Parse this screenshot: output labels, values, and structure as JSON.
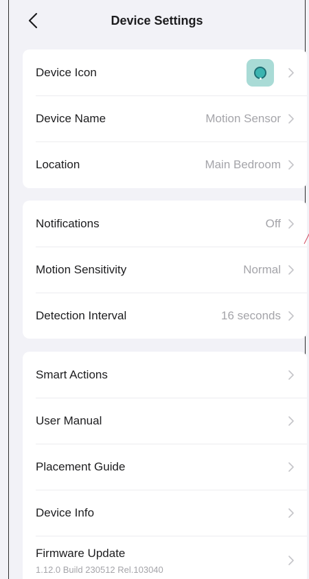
{
  "header": {
    "title": "Device Settings",
    "back_icon": "chevron-left-icon"
  },
  "group1": {
    "device_icon_label": "Device Icon",
    "device_icon_color": "#a9dbd6",
    "device_name_label": "Device Name",
    "device_name_value": "Motion Sensor",
    "location_label": "Location",
    "location_value": "Main Bedroom"
  },
  "group2": {
    "notifications_label": "Notifications",
    "notifications_value": "Off",
    "motion_sensitivity_label": "Motion Sensitivity",
    "motion_sensitivity_value": "Normal",
    "detection_interval_label": "Detection Interval",
    "detection_interval_value": "16 seconds"
  },
  "group3": {
    "smart_actions_label": "Smart Actions",
    "user_manual_label": "User Manual",
    "placement_guide_label": "Placement Guide",
    "device_info_label": "Device Info",
    "firmware_update_label": "Firmware Update",
    "firmware_version": "1.12.0 Build 230512 Rel.103040"
  },
  "colors": {
    "background": "#f2f2f7",
    "card": "#ffffff",
    "secondary_text": "#a4a4a9",
    "accent_teal": "#3bb4b0"
  }
}
